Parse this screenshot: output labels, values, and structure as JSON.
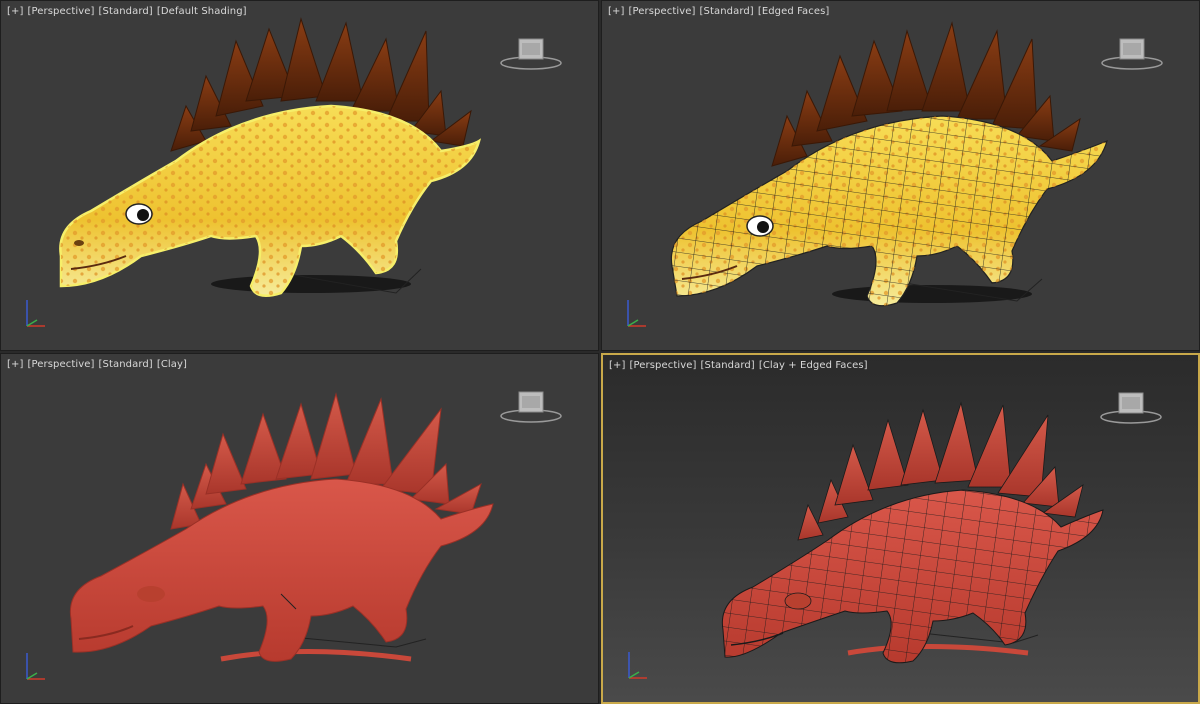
{
  "viewports": [
    {
      "id": "top-left",
      "label": {
        "plus": "[+]",
        "view": "[Perspective]",
        "camera": "[Standard]",
        "shading": "[Default Shading]"
      },
      "mode": "textured",
      "active": false
    },
    {
      "id": "top-right",
      "label": {
        "plus": "[+]",
        "view": "[Perspective]",
        "camera": "[Standard]",
        "shading": "[Edged Faces]"
      },
      "mode": "textured-wire",
      "active": false
    },
    {
      "id": "bottom-left",
      "label": {
        "plus": "[+]",
        "view": "[Perspective]",
        "camera": "[Standard]",
        "shading": "[Clay]"
      },
      "mode": "clay",
      "active": false
    },
    {
      "id": "bottom-right",
      "label": {
        "plus": "[+]",
        "view": "[Perspective]",
        "camera": "[Standard]",
        "shading": "[Clay + Edged Faces]"
      },
      "mode": "clay-wire",
      "active": true
    }
  ],
  "colors": {
    "accent_active": "#c9a94a",
    "viewport_bg": "#3b3b3b",
    "body_textured": "#f2cd3a",
    "plates_textured": "#6b2e10",
    "body_clay": "#c9483a",
    "selection_outline": "#f6ef6a",
    "axis_x": "#d03a2a",
    "axis_y": "#3ab04a",
    "axis_z": "#3a5ad0"
  },
  "icons": {
    "viewcube": "viewcube-icon",
    "axis": "axis-tripod-icon",
    "model": "stegosaurus-model"
  }
}
